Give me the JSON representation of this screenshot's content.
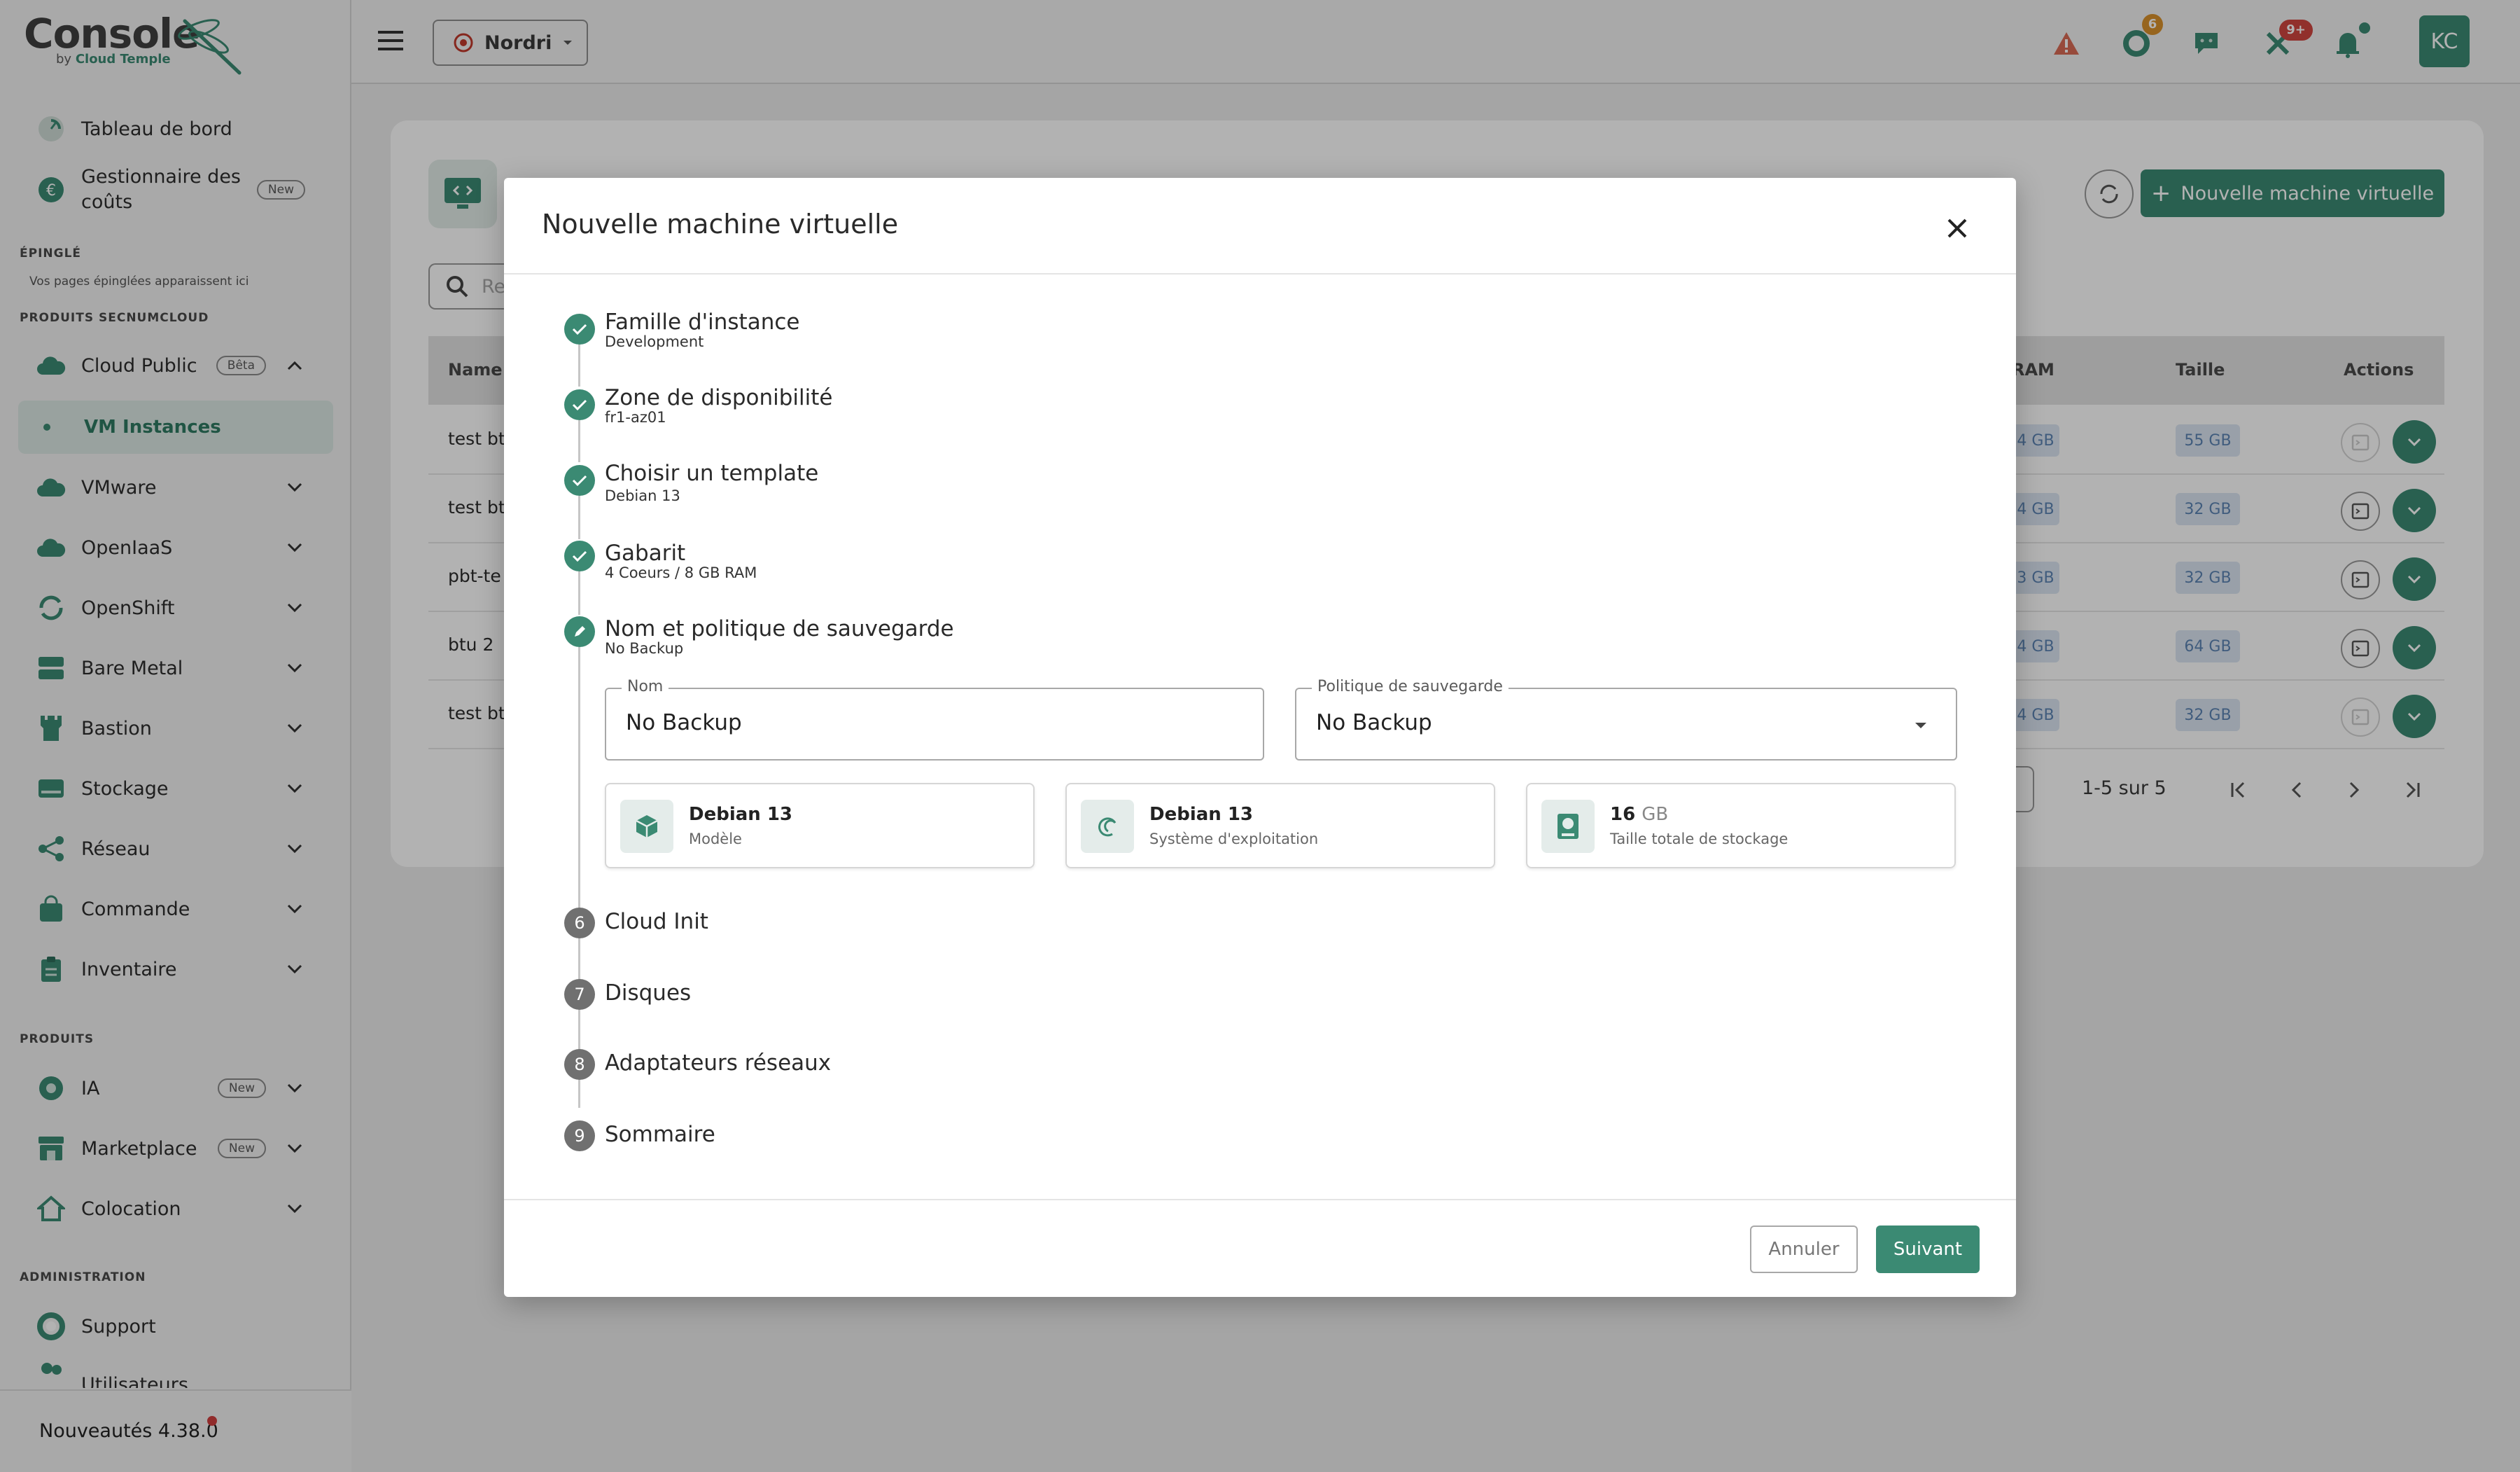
{
  "app": {
    "logo_text": "Console",
    "logo_by": "by",
    "logo_brand": "Cloud Temple"
  },
  "sidebar": {
    "top_items": [
      {
        "label": "Tableau de bord",
        "icon": "dashboard-icon"
      },
      {
        "label": "Gestionnaire des",
        "label2": "coûts",
        "icon": "euro-icon",
        "badge": "New"
      }
    ],
    "pinned": {
      "title": "ÉPINGLÉ",
      "empty_text": "Vos pages épinglées apparaissent ici"
    },
    "secnum": {
      "title": "PRODUITS SECNUMCLOUD",
      "items": [
        {
          "label": "Cloud Public",
          "badge": "Bêta",
          "expanded": true
        },
        {
          "label": "VM Instances",
          "active": true
        },
        {
          "label": "VMware"
        },
        {
          "label": "OpenIaaS"
        },
        {
          "label": "OpenShift"
        },
        {
          "label": "Bare Metal"
        },
        {
          "label": "Bastion"
        },
        {
          "label": "Stockage"
        },
        {
          "label": "Réseau"
        },
        {
          "label": "Commande"
        },
        {
          "label": "Inventaire"
        }
      ]
    },
    "produits": {
      "title": "PRODUITS",
      "items": [
        {
          "label": "IA",
          "badge": "New"
        },
        {
          "label": "Marketplace",
          "badge": "New"
        },
        {
          "label": "Colocation"
        }
      ]
    },
    "admin": {
      "title": "ADMINISTRATION",
      "items": [
        {
          "label": "Support"
        },
        {
          "label": "Utilisateurs"
        }
      ]
    },
    "footer": {
      "label": "Nouveautés 4.38.0"
    }
  },
  "header": {
    "tenant": "Nordri",
    "badges": {
      "orders": "6",
      "alerts": "9+"
    },
    "avatar": "KC"
  },
  "page": {
    "new_vm_button": "Nouvelle machine virtuelle",
    "search_placeholder": "Re",
    "table": {
      "headers": {
        "name": "Name",
        "ram": "RAM",
        "size": "Taille",
        "actions": "Actions"
      },
      "rows": [
        {
          "name": "test btu",
          "ram": "4 GB",
          "size": "55 GB",
          "console_enabled": false
        },
        {
          "name": "test btu",
          "ram": "4 GB",
          "size": "32 GB",
          "console_enabled": true
        },
        {
          "name": "pbt-te",
          "ram": "3 GB",
          "size": "32 GB",
          "console_enabled": true
        },
        {
          "name": "btu 2",
          "ram": "4 GB",
          "size": "64 GB",
          "console_enabled": true
        },
        {
          "name": "test btu",
          "ram": "4 GB",
          "size": "32 GB",
          "console_enabled": false
        }
      ]
    },
    "pagination": "1-5 sur 5"
  },
  "modal": {
    "title": "Nouvelle machine virtuelle",
    "steps": [
      {
        "title": "Famille d'instance",
        "subtitle": "Development",
        "state": "done"
      },
      {
        "title": "Zone de disponibilité",
        "subtitle": "fr1-az01",
        "state": "done"
      },
      {
        "title": "Choisir un template",
        "subtitle": "Debian 13",
        "state": "done"
      },
      {
        "title": "Gabarit",
        "subtitle": "4 Coeurs / 8 GB RAM",
        "state": "done"
      },
      {
        "title": "Nom et politique de sauvegarde",
        "subtitle": "No Backup",
        "state": "editing"
      },
      {
        "number": "6",
        "title": "Cloud Init",
        "state": "pending"
      },
      {
        "number": "7",
        "title": "Disques",
        "state": "pending"
      },
      {
        "number": "8",
        "title": "Adaptateurs réseaux",
        "state": "pending"
      },
      {
        "number": "9",
        "title": "Sommaire",
        "state": "pending"
      }
    ],
    "form": {
      "name_label": "Nom",
      "name_value": "No Backup",
      "policy_label": "Politique de sauvegarde",
      "policy_value": "No Backup"
    },
    "cards": [
      {
        "main": "Debian 13",
        "sub": "Modèle",
        "icon": "cube-icon"
      },
      {
        "main": "Debian 13",
        "sub": "Système d'exploitation",
        "icon": "debian-swirl-icon"
      },
      {
        "main": "16",
        "unit": "GB",
        "sub": "Taille totale de stockage",
        "icon": "hard-drive-icon"
      }
    ],
    "cancel_label": "Annuler",
    "next_label": "Suivant"
  },
  "colors": {
    "brand": "#3b8a73",
    "chip_bg": "#dce6f3",
    "chip_text": "#5c84b4",
    "badge_orange": "#d9912c",
    "badge_red": "#d0453f"
  }
}
